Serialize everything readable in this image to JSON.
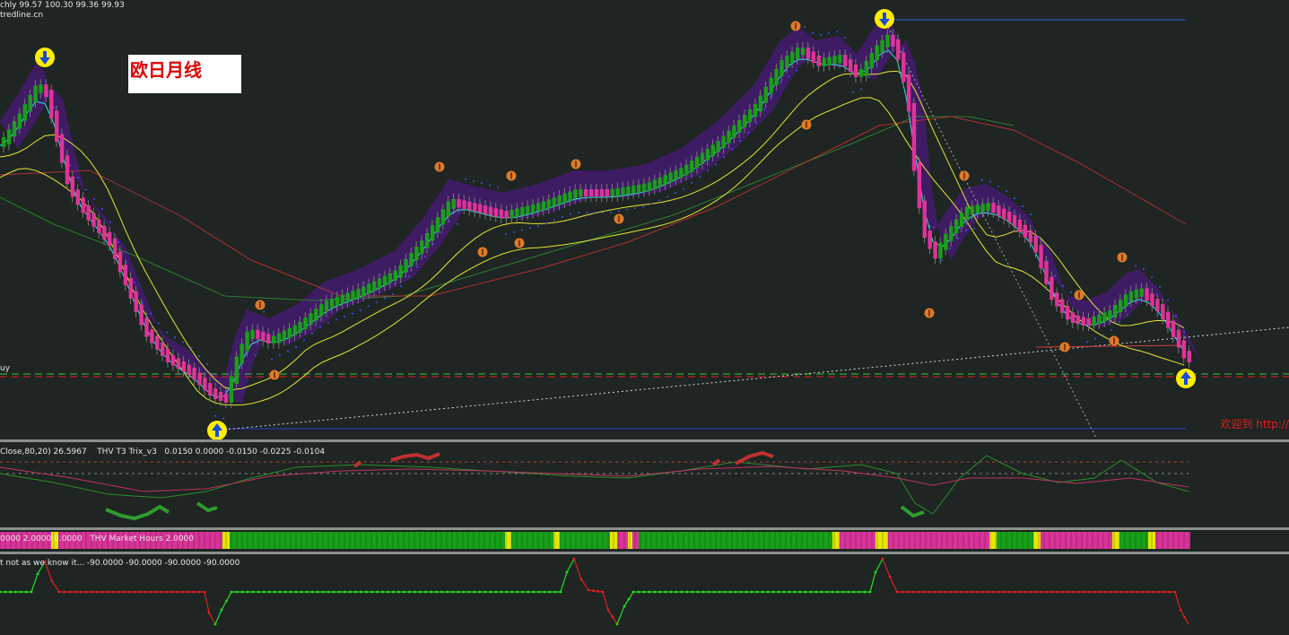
{
  "header": {
    "ohlc_prefix": "chly",
    "ohlc_values": "99.57 100.30 99.36 99.93",
    "site": "tredline.cn",
    "buy_label": "uy"
  },
  "note": {
    "text": "欧日月线"
  },
  "footer": {
    "welcome": "欢迎到 http://"
  },
  "indicators": {
    "trix": {
      "prefix": "Close,80,20) 26.5967",
      "name": "THV T3 Trix_v3",
      "values": "0.0150 0.0000 -0.0150 -0.0225 -0.0104"
    },
    "market_hours": {
      "prefix": "0000 2.0000 0.0000",
      "name": "THV Market Hours 2.0000"
    },
    "oscillator": {
      "text": "t not as we know it... -90.0000 -90.0000 -90.0000 -90.0000"
    }
  },
  "colors": {
    "background": "#1e2522",
    "bull_candle": "#18a018",
    "bear_candle": "#e0339a",
    "cyan_ma": "#33e6e6",
    "yellow_ma": "#e6e633",
    "red_ma": "#b03030",
    "green_ma": "#2e7d32",
    "cloud": "#4a1a7a",
    "market_green": "#18a018",
    "market_pink": "#d9339a",
    "market_yellow": "#e6e600",
    "osc_up": "#22e022",
    "osc_down": "#e02020",
    "arrow_circle": "#ffee00",
    "arrow_fill": "#1a4ad9",
    "marker": "#e07a2a"
  },
  "icons": {
    "arrow_down": "down-arrow-signal-icon",
    "arrow_up": "up-arrow-signal-icon",
    "marker": "alert-marker-icon"
  }
}
